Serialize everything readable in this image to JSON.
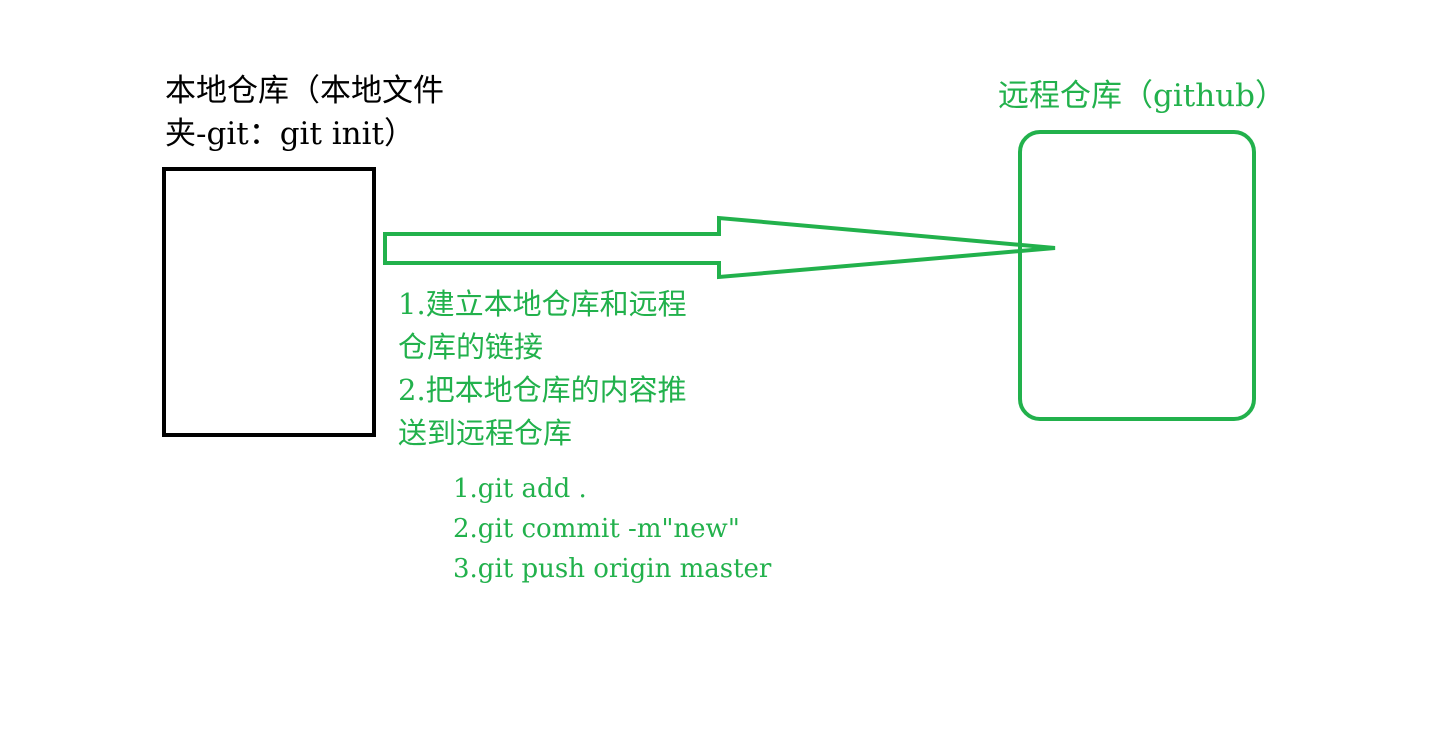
{
  "colors": {
    "local": "#000000",
    "remote": "#22b14c"
  },
  "local_repo": {
    "label_line1": "本地仓库（本地文件",
    "label_line2": "夹-git：git init）"
  },
  "remote_repo": {
    "label": "远程仓库（github）"
  },
  "steps": [
    "1.建立本地仓库和远程",
    "仓库的链接",
    "2.把本地仓库的内容推",
    "送到远程仓库"
  ],
  "commands": [
    "1.git add .",
    "2.git commit -m\"new\"",
    "3.git push origin master"
  ]
}
